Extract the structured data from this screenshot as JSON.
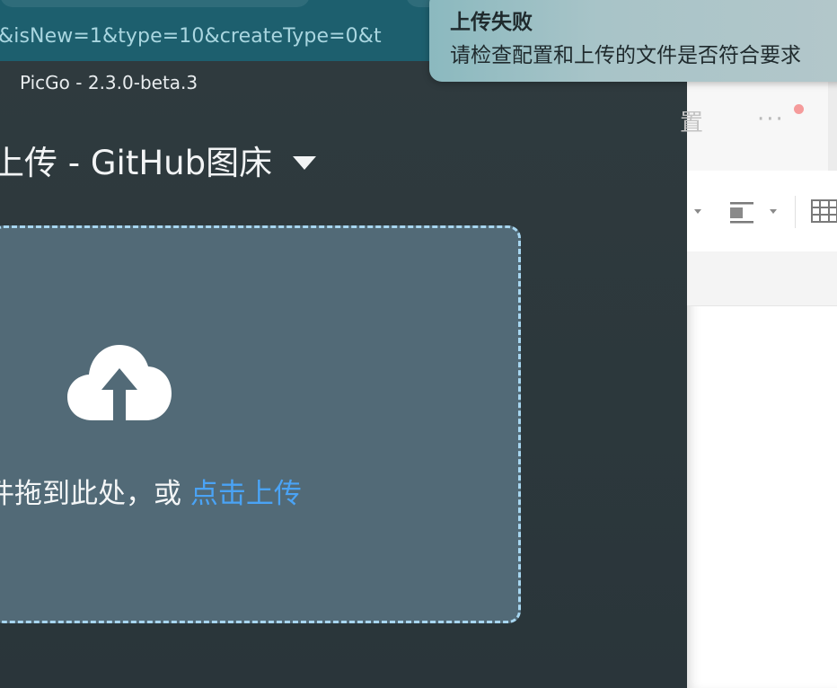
{
  "browser": {
    "url_fragment": "&isNew=1&type=10&createType=0&t"
  },
  "picgo": {
    "window_title": "PicGo - 2.3.0-beta.3",
    "upload_title": "上传 - GitHub图床",
    "drop_text": "件拖到此处，或",
    "drop_link": "点击上传"
  },
  "editor": {
    "tab_partial_label": "置",
    "more_label": "···"
  },
  "notification": {
    "title": "上传失败",
    "body": "请检查配置和上传的文件是否符合要求"
  },
  "colors": {
    "link": "#4aa3f5",
    "dropzone_bg": "#526a77",
    "dropzone_border": "#a7d6f0",
    "badge_dot": "#f59b9b"
  },
  "icons": {
    "upload": "cloud-upload-icon",
    "dropdown": "caret-down-icon",
    "align": "align-left-icon",
    "table": "table-icon"
  }
}
